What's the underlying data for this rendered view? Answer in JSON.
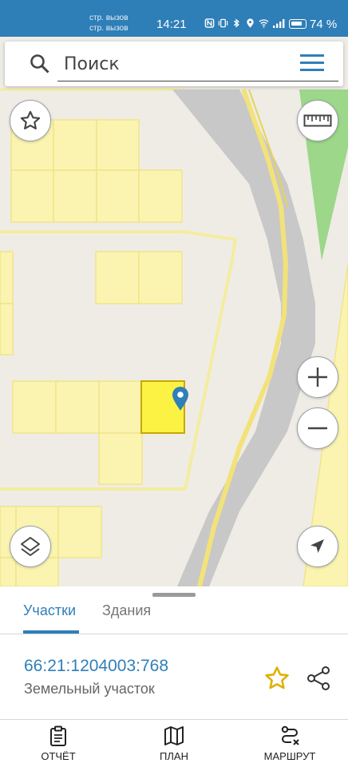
{
  "status_bar": {
    "carrier_line1": "стр. вызов",
    "carrier_line2": "стр. вызов",
    "time": "14:21",
    "battery_percent": "74 %"
  },
  "search": {
    "placeholder": "Поиск"
  },
  "tabs": [
    {
      "label": "Участки",
      "active": true
    },
    {
      "label": "Здания",
      "active": false
    }
  ],
  "selected_parcel": {
    "cadastral_number": "66:21:1204003:768",
    "type": "Земельный участок"
  },
  "bottom_nav": [
    {
      "label": "ОТЧЁТ",
      "icon": "report-icon"
    },
    {
      "label": "ПЛАН",
      "icon": "map-plan-icon"
    },
    {
      "label": "МАРШРУТ",
      "icon": "route-icon"
    }
  ],
  "colors": {
    "accent": "#2f7fb8",
    "parcel_fill": "#fbf4b0",
    "selected_parcel": "#fbf244",
    "road": "#c8c8c8",
    "highway_stripe": "#f2e27a",
    "green_area": "#9cd78a",
    "favorite_star": "#f0c419"
  }
}
